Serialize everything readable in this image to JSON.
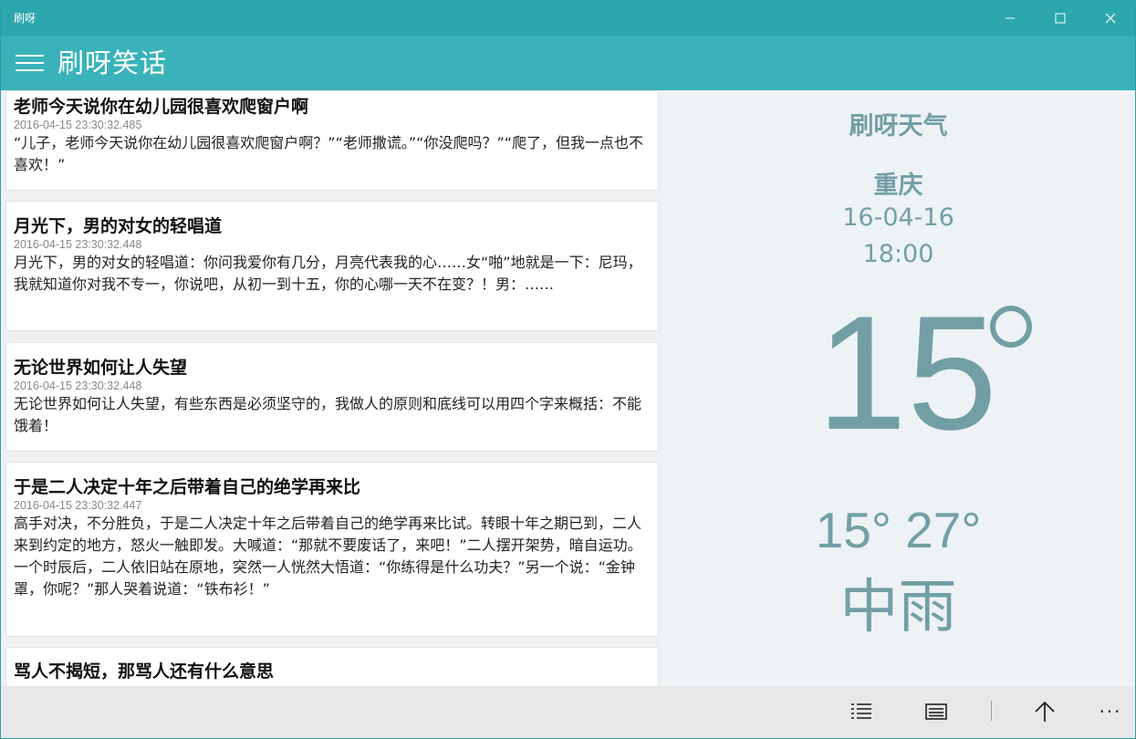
{
  "window": {
    "title": "刷呀"
  },
  "appbar": {
    "title": "刷呀笑话"
  },
  "feed": [
    {
      "title": "老师今天说你在幼儿园很喜欢爬窗户啊",
      "date": "2016-04-15 23:30:32.485",
      "body": "“儿子，老师今天说你在幼儿园很喜欢爬窗户啊？”“老师撒谎。”“你没爬吗？”“爬了，但我一点也不喜欢！”"
    },
    {
      "title": "月光下，男的对女的轻唱道",
      "date": "2016-04-15 23:30:32.448",
      "body": "月光下，男的对女的轻唱道：你问我爱你有几分，月亮代表我的心……女“啪”地就是一下：尼玛，我就知道你对我不专一，你说吧，从初一到十五，你的心哪一天不在变？！男：……"
    },
    {
      "title": "无论世界如何让人失望",
      "date": "2016-04-15 23:30:32.448",
      "body": "无论世界如何让人失望，有些东西是必须坚守的，我做人的原则和底线可以用四个字来概括：不能饿着！"
    },
    {
      "title": "于是二人决定十年之后带着自己的绝学再来比",
      "date": "2016-04-15 23:30:32.447",
      "body": "高手对决，不分胜负，于是二人决定十年之后带着自己的绝学再来比试。转眼十年之期已到，二人来到约定的地方，怒火一触即发。大喊道：“那就不要废话了，来吧！”二人摆开架势，暗自运功。一个时辰后，二人依旧站在原地，突然一人恍然大悟道：“你练得是什么功夫？”另一个说：“金钟罩，你呢？”那人哭着说道：“铁布衫！”"
    },
    {
      "title": "骂人不揭短，那骂人还有什么意思",
      "date": "",
      "body": ""
    }
  ],
  "weather": {
    "title": "刷呀天气",
    "city": "重庆",
    "date": "16-04-16",
    "time": "18:00",
    "temp": "15",
    "range": "15° 27°",
    "condition": "中雨",
    "text_color": "#729fa5"
  },
  "bottombar": {
    "more_label": "···",
    "icons": [
      "list-icon",
      "newspaper-icon",
      "arrow-up-icon"
    ]
  },
  "colors": {
    "titlebar": "#2ba7ad",
    "appbar": "#39b3b9"
  }
}
